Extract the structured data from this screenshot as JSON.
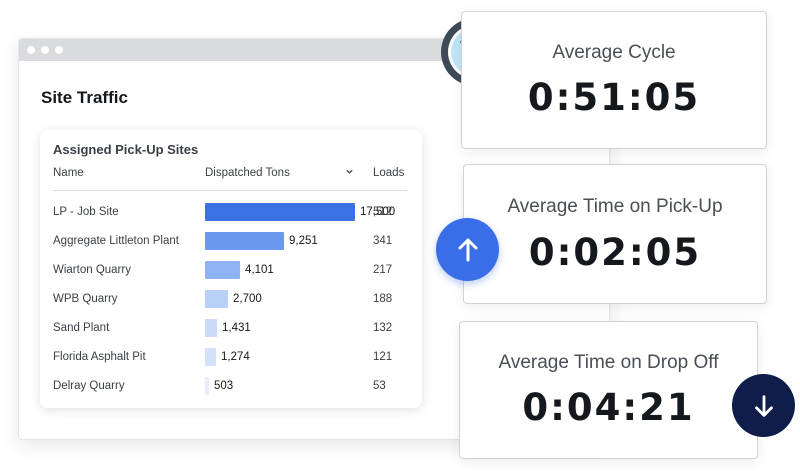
{
  "window": {
    "title": "Site Traffic"
  },
  "table": {
    "title": "Assigned Pick-Up Sites",
    "headers": {
      "name": "Name",
      "tons": "Dispatched Tons",
      "loads": "Loads"
    },
    "rows": [
      {
        "name": "LP - Job Site",
        "tons": "17,500",
        "tons_value": 17500,
        "loads": "512",
        "color": "#3a72e6"
      },
      {
        "name": "Aggregate Littleton Plant",
        "tons": "9,251",
        "tons_value": 9251,
        "loads": "341",
        "color": "#6b98ee"
      },
      {
        "name": "Wiarton Quarry",
        "tons": "4,101",
        "tons_value": 4101,
        "loads": "217",
        "color": "#8fb2f2"
      },
      {
        "name": "WPB Quarry",
        "tons": "2,700",
        "tons_value": 2700,
        "loads": "188",
        "color": "#b8cff7"
      },
      {
        "name": "Sand Plant",
        "tons": "1,431",
        "tons_value": 1431,
        "loads": "132",
        "color": "#cadcf9"
      },
      {
        "name": "Florida Asphalt Pit",
        "tons": "1,274",
        "tons_value": 1274,
        "loads": "121",
        "color": "#d3e2fa"
      },
      {
        "name": "Delray Quarry",
        "tons": "503",
        "tons_value": 503,
        "loads": "53",
        "color": "#e6eefc"
      }
    ]
  },
  "metrics": {
    "cycle": {
      "label": "Average Cycle",
      "value": "0:51:05"
    },
    "pickup": {
      "label": "Average Time on Pick-Up",
      "value": "0:02:05"
    },
    "dropoff": {
      "label": "Average Time on Drop Off",
      "value": "0:04:21"
    }
  },
  "icons": {
    "clock": "clock-icon",
    "up": "arrow-up-icon",
    "down": "arrow-down-icon",
    "chevron": "chevron-down-icon"
  },
  "colors": {
    "accent": "#3a6ee8",
    "navy": "#0f1d4a",
    "clock_ring": "#3f4a57",
    "clock_face": "#bfe6f7"
  }
}
